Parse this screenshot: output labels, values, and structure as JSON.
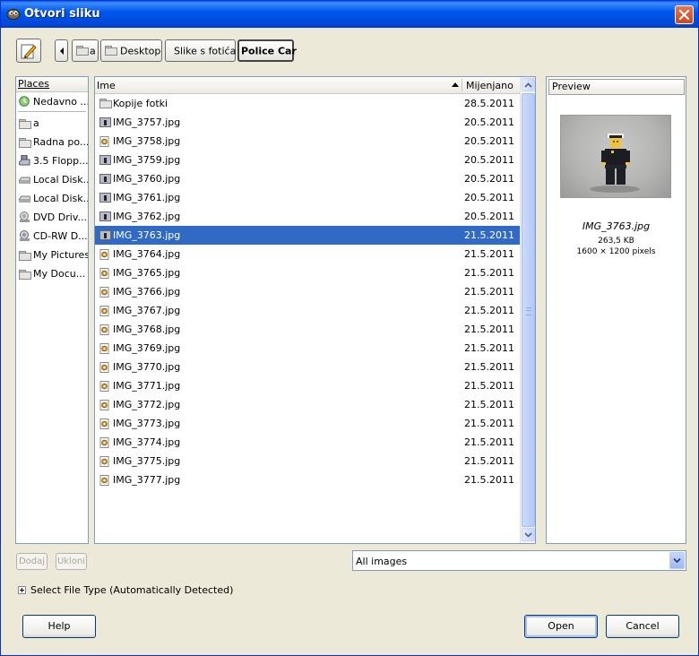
{
  "window": {
    "title": "Otvori sliku"
  },
  "breadcrumb": [
    "a",
    "Desktop",
    "Slike s fotića",
    "Police Car"
  ],
  "places": {
    "header": "Places",
    "items": [
      {
        "label": "Nedavno ...",
        "icon": "recent-icon"
      },
      {
        "label": "a",
        "icon": "folder-icon"
      },
      {
        "label": "Radna po...",
        "icon": "folder-icon"
      },
      {
        "label": "3.5 Flopp...",
        "icon": "floppy-icon"
      },
      {
        "label": "Local Disk...",
        "icon": "harddisk-icon"
      },
      {
        "label": "Local Disk...",
        "icon": "harddisk-icon"
      },
      {
        "label": "DVD Driv...",
        "icon": "dvd-icon"
      },
      {
        "label": "CD-RW D...",
        "icon": "cdrw-icon"
      },
      {
        "label": "My Pictures",
        "icon": "folder-icon"
      },
      {
        "label": "My Docu...",
        "icon": "folder-icon"
      }
    ]
  },
  "files": {
    "col_name": "Ime",
    "col_date": "Mijenjano",
    "rows": [
      {
        "name": "Kopije fotki",
        "date": "28.5.2011",
        "icon": "folder-icon"
      },
      {
        "name": "IMG_3757.jpg",
        "date": "20.5.2011",
        "icon": "image-thumb-icon"
      },
      {
        "name": "IMG_3758.jpg",
        "date": "20.5.2011",
        "icon": "image-icon"
      },
      {
        "name": "IMG_3759.jpg",
        "date": "20.5.2011",
        "icon": "image-thumb-icon"
      },
      {
        "name": "IMG_3760.jpg",
        "date": "20.5.2011",
        "icon": "image-thumb-icon"
      },
      {
        "name": "IMG_3761.jpg",
        "date": "20.5.2011",
        "icon": "image-thumb-icon"
      },
      {
        "name": "IMG_3762.jpg",
        "date": "20.5.2011",
        "icon": "image-thumb-icon"
      },
      {
        "name": "IMG_3763.jpg",
        "date": "21.5.2011",
        "icon": "image-thumb-icon",
        "selected": true
      },
      {
        "name": "IMG_3764.jpg",
        "date": "21.5.2011",
        "icon": "image-icon"
      },
      {
        "name": "IMG_3765.jpg",
        "date": "21.5.2011",
        "icon": "image-icon"
      },
      {
        "name": "IMG_3766.jpg",
        "date": "21.5.2011",
        "icon": "image-icon"
      },
      {
        "name": "IMG_3767.jpg",
        "date": "21.5.2011",
        "icon": "image-icon"
      },
      {
        "name": "IMG_3768.jpg",
        "date": "21.5.2011",
        "icon": "image-icon"
      },
      {
        "name": "IMG_3769.jpg",
        "date": "21.5.2011",
        "icon": "image-icon"
      },
      {
        "name": "IMG_3770.jpg",
        "date": "21.5.2011",
        "icon": "image-icon"
      },
      {
        "name": "IMG_3771.jpg",
        "date": "21.5.2011",
        "icon": "image-icon"
      },
      {
        "name": "IMG_3772.jpg",
        "date": "21.5.2011",
        "icon": "image-icon"
      },
      {
        "name": "IMG_3773.jpg",
        "date": "21.5.2011",
        "icon": "image-icon"
      },
      {
        "name": "IMG_3774.jpg",
        "date": "21.5.2011",
        "icon": "image-icon"
      },
      {
        "name": "IMG_3775.jpg",
        "date": "21.5.2011",
        "icon": "image-icon"
      },
      {
        "name": "IMG_3777.jpg",
        "date": "21.5.2011",
        "icon": "image-icon"
      }
    ]
  },
  "preview": {
    "tab_label": "Preview",
    "file_name": "IMG_3763.jpg",
    "file_size": "263,5 KB",
    "dimensions": "1600 × 1200 pixels"
  },
  "bottom": {
    "add_label": "Dodaj",
    "remove_label": "Ukloni",
    "filter_value": "All images",
    "filetype_label": "Select File Type (Automatically Detected)",
    "help_label": "Help",
    "open_label": "Open",
    "cancel_label": "Cancel"
  },
  "colors": {
    "selection": "#316ac5",
    "titlebar": "#0054e3"
  }
}
